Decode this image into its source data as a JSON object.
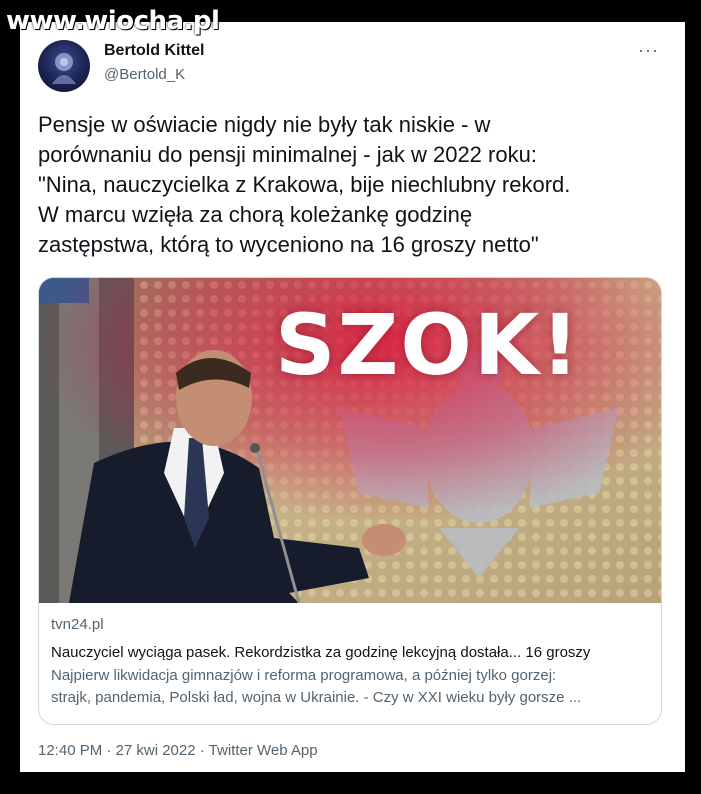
{
  "watermark": "www.wiocha.pl",
  "tweet": {
    "author_name": "Bertold Kittel",
    "author_handle": "@Bertold_K",
    "more_icon": "more-dots-icon",
    "text_lines": [
      "Pensje w oświacie nigdy nie były tak niskie - w",
      "porównaniu do pensji minimalnej - jak w 2022 roku:",
      "\"Nina, nauczycielka z Krakowa, bije niechlubny rekord.",
      "W marcu wzięła za chorą koleżankę godzinę",
      "zastępstwa, którą to wyceniono na 16 groszy netto\""
    ],
    "timestamp": "12:40 PM · 27 kwi 2022 · Twitter Web App"
  },
  "link_card": {
    "image_overlay_text": "SZOK!",
    "domain": "tvn24.pl",
    "headline": "Nauczyciel wyciąga pasek. Rekordzistka za godzinę lekcyjną dostała... 16 groszy",
    "description_lines": [
      "Najpierw likwidacja gimnazjów i reforma programowa, a później tylko gorzej:",
      "strajk, pandemia, Polski ład, wojna w Ukrainie. - Czy w XXI wieku były gorsze ..."
    ]
  },
  "colors": {
    "background": "#000000",
    "card": "#ffffff",
    "text_primary": "#0f1419",
    "text_secondary": "#536471",
    "border": "#cfd9de"
  }
}
